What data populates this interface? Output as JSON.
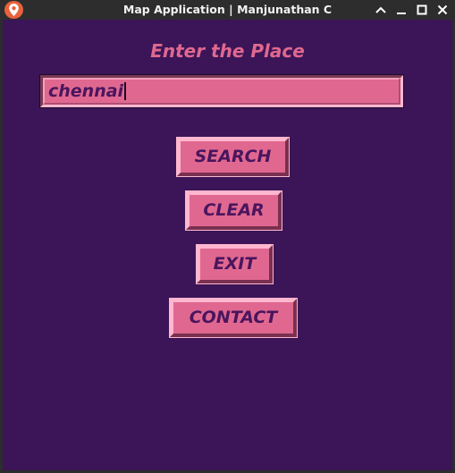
{
  "window": {
    "title": "Map Application | Manjunathan C"
  },
  "icons": {
    "app": "map-pin-icon",
    "controls": [
      "chevron-up-icon",
      "minimize-icon",
      "maximize-icon",
      "close-icon"
    ]
  },
  "colors": {
    "background": "#3b1557",
    "accent": "#e06890",
    "text": "#4a155e"
  },
  "form": {
    "heading": "Enter the Place",
    "place_value": "chennai"
  },
  "buttons": {
    "search": "SEARCH",
    "clear": "CLEAR",
    "exit": "EXIT",
    "contact": "CONTACT"
  }
}
